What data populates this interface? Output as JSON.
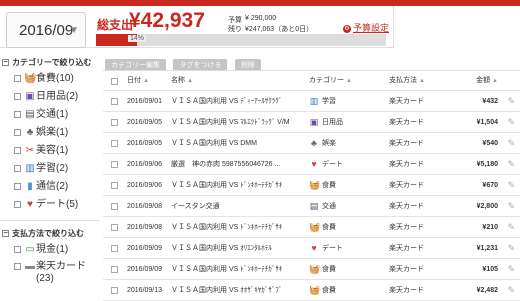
{
  "header": {
    "month": "2016/09",
    "total_label": "総支出",
    "total_value": "¥42,937",
    "budget_label": "予算",
    "budget_value": "¥ 290,000",
    "remain_label": "残り",
    "remain_value": "¥247,063（あと0日）",
    "budget_setting": "予算設定",
    "progress_pct": "14%",
    "progress_fraction": 0.14,
    "accent_color": "#c8281e"
  },
  "sidebar": {
    "category_title": "カテゴリーで絞り込む",
    "categories": [
      {
        "icon": "basket-icon",
        "label": "食費(10)"
      },
      {
        "icon": "shopping-bag-icon",
        "label": "日用品(2)"
      },
      {
        "icon": "train-icon",
        "label": "交通(1)"
      },
      {
        "icon": "game-controller-icon",
        "label": "娯楽(1)"
      },
      {
        "icon": "scissors-icon",
        "label": "美容(1)"
      },
      {
        "icon": "book-icon",
        "label": "学習(2)"
      },
      {
        "icon": "signal-icon",
        "label": "通信(2)"
      },
      {
        "icon": "heart-icon",
        "label": "デート(5)"
      }
    ],
    "payment_title": "支払方法で絞り込む",
    "payments": [
      {
        "icon": "cash-icon",
        "label": "現金(1)"
      },
      {
        "icon": "card-icon",
        "label": "楽天カード\n(23)"
      }
    ]
  },
  "toolbar": {
    "edit_category": "カテゴリー編集",
    "tag": "タグをつける",
    "delete": "削除"
  },
  "table": {
    "headers": {
      "date": "日付",
      "name": "名称",
      "category": "カテゴリー",
      "payment": "支払方法",
      "amount": "金額"
    },
    "rows": [
      {
        "date": "2016/09/01",
        "name": "ＶＩＳＡ国内利用 VS ﾃﾞｨｰｱｰﾙｻｸﾗｸﾞ",
        "cat_icon": "book-icon",
        "category": "学習",
        "payment": "楽天カード",
        "amount": "¥432"
      },
      {
        "date": "2016/09/05",
        "name": "ＶＩＳＡ国内利用 VS ﾏﾙｴﾂﾄﾞﾗｯｸﾞ V/M",
        "cat_icon": "shopping-bag-icon",
        "category": "日用品",
        "payment": "楽天カード",
        "amount": "¥1,504"
      },
      {
        "date": "2016/09/05",
        "name": "ＶＩＳＡ国内利用 VS DMM",
        "cat_icon": "game-controller-icon",
        "category": "娯楽",
        "payment": "楽天カード",
        "amount": "¥540"
      },
      {
        "date": "2016/09/06",
        "name": "厳選　神の赤肉 5987556046726 ...",
        "cat_icon": "heart-icon",
        "category": "デート",
        "payment": "楽天カード",
        "amount": "¥5,180"
      },
      {
        "date": "2016/09/06",
        "name": "ＶＩＳＡ国内利用 VS ﾄﾞﾝｷﾎｰﾃﾁｶﾞｻｷ",
        "cat_icon": "basket-icon",
        "category": "食費",
        "payment": "楽天カード",
        "amount": "¥670"
      },
      {
        "date": "2016/09/08",
        "name": "イースタン交通",
        "cat_icon": "train-icon",
        "category": "交通",
        "payment": "楽天カード",
        "amount": "¥2,800"
      },
      {
        "date": "2016/09/08",
        "name": "ＶＩＳＡ国内利用 VS ﾄﾞﾝｷﾎｰﾃﾁｶﾞｻｷ",
        "cat_icon": "basket-icon",
        "category": "食費",
        "payment": "楽天カード",
        "amount": "¥210"
      },
      {
        "date": "2016/09/09",
        "name": "ＶＩＳＡ国内利用 VS ｵﾘｴﾝﾀﾙﾎﾃﾙ",
        "cat_icon": "heart-icon",
        "category": "デート",
        "payment": "楽天カード",
        "amount": "¥1,231"
      },
      {
        "date": "2016/09/09",
        "name": "ＶＩＳＡ国内利用 VS ﾄﾞﾝｷﾎｰﾃﾁｶﾞｻｷ",
        "cat_icon": "basket-icon",
        "category": "食費",
        "payment": "楽天カード",
        "amount": "¥105"
      },
      {
        "date": "2016/09/13",
        "name": "ＶＩＳＡ国内利用 VS ｵｵｻﾞｷﾔｶﾞｻﾞﾌﾞ",
        "cat_icon": "basket-icon",
        "category": "食費",
        "payment": "楽天カード",
        "amount": "¥2,482"
      }
    ]
  }
}
